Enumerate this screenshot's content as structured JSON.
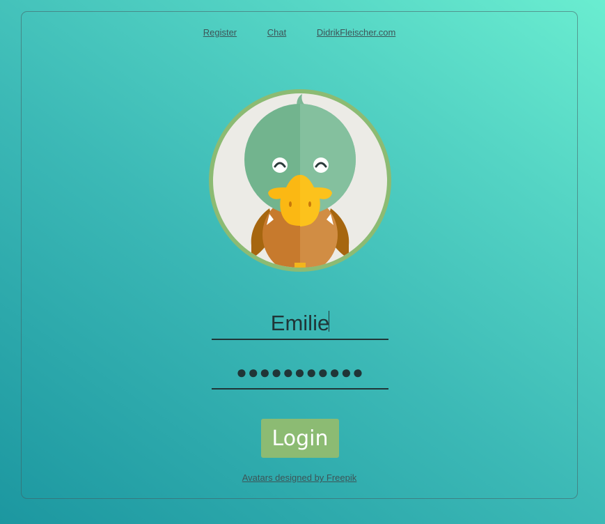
{
  "nav": {
    "register": "Register",
    "chat": "Chat",
    "site": "DidrikFleischer.com"
  },
  "avatar": {
    "icon": "duck-avatar-icon",
    "ring_color": "#8cbb73",
    "background_color": "#ecebe6"
  },
  "form": {
    "username_value": "Emilie",
    "password_value": "●●●●●●●●●●●",
    "login_label": "Login"
  },
  "footer": {
    "credit": "Avatars designed by Freepik"
  },
  "colors": {
    "accent": "#8cbb73",
    "text_dark": "#203537",
    "link": "#3d5457"
  }
}
